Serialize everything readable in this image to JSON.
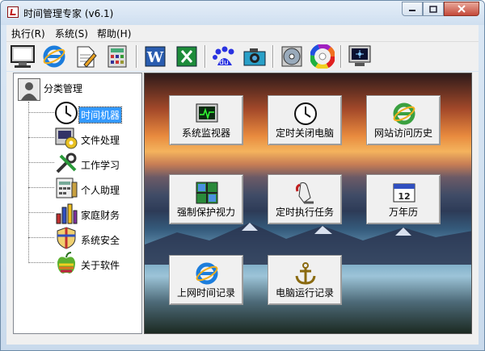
{
  "window": {
    "title": "时间管理专家 (v6.1)"
  },
  "menu": [
    {
      "label": "执行(R)"
    },
    {
      "label": "系统(S)"
    },
    {
      "label": "帮助(H)"
    }
  ],
  "toolbar": [
    {
      "icon": "monitor-icon"
    },
    {
      "icon": "ie-icon"
    },
    {
      "icon": "notepad-icon"
    },
    {
      "icon": "calculator-icon"
    },
    {
      "icon": "word-icon"
    },
    {
      "icon": "excel-icon"
    },
    {
      "icon": "baidu-icon"
    },
    {
      "icon": "camera-icon"
    },
    {
      "icon": "disc-icon"
    },
    {
      "icon": "color-wheel-icon"
    },
    {
      "icon": "screen-icon"
    }
  ],
  "tree": {
    "root": {
      "label": "分类管理"
    },
    "items": [
      {
        "label": "时间机器",
        "selected": true,
        "icon": "clock-icon"
      },
      {
        "label": "文件处理",
        "icon": "file-process-icon"
      },
      {
        "label": "工作学习",
        "icon": "tools-icon"
      },
      {
        "label": "个人助理",
        "icon": "organizer-icon"
      },
      {
        "label": "家庭财务",
        "icon": "finance-chart-icon"
      },
      {
        "label": "系统安全",
        "icon": "security-shield-icon"
      },
      {
        "label": "关于软件",
        "icon": "apple-icon"
      }
    ]
  },
  "functions": [
    {
      "label": "系统监视器",
      "icon": "monitor-chart-icon"
    },
    {
      "label": "定时关闭电脑",
      "icon": "clock-icon"
    },
    {
      "label": "网站访问历史",
      "icon": "ie-icon"
    },
    {
      "label": "强制保护视力",
      "icon": "grid-icon"
    },
    {
      "label": "定时执行任务",
      "icon": "hand-pointer-icon"
    },
    {
      "label": "万年历",
      "icon": "calendar-icon"
    },
    {
      "label": "上网时间记录",
      "icon": "ie-icon"
    },
    {
      "label": "电脑运行记录",
      "icon": "anchor-icon"
    }
  ]
}
